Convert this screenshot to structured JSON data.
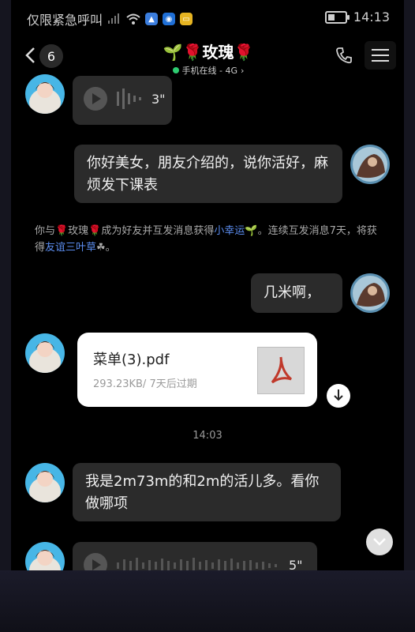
{
  "status_bar": {
    "carrier": "仅限紧急呼叫",
    "time": "14:13",
    "icons": [
      "signal-icon",
      "wifi-icon",
      "app-badge-icon",
      "app-badge-icon",
      "notes-icon"
    ]
  },
  "header": {
    "unread_count": "6",
    "title": "🌱🌹玫瑰🌹",
    "status": "手机在线 - 4G",
    "status_arrow": "›"
  },
  "messages": {
    "voice_top": {
      "duration": "3\""
    },
    "sent_1": {
      "text": "你好美女，朋友介绍的，说你活好，麻烦发下课表"
    },
    "system": {
      "part1": "你与🌹玫瑰🌹成为好友并互发消息获得",
      "link1": "小幸运",
      "part2": "🌱。连续互发消息7天，将获得",
      "link2": "友谊三叶草",
      "part3": "☘。"
    },
    "sent_2": {
      "text": "几米啊，"
    },
    "file": {
      "name": "菜单(3).pdf",
      "meta": "293.23KB/ 7天后过期"
    },
    "time_divider": "14:03",
    "recv_2": {
      "text": "我是2m73m的和2m的活儿多。看你做哪项"
    },
    "voice_bottom": {
      "duration": "5\""
    }
  },
  "colors": {
    "background": "#000000",
    "bubble": "#2b2b2b",
    "link": "#5b8def",
    "online": "#2ecc71",
    "pdf_red": "#c0392b"
  }
}
